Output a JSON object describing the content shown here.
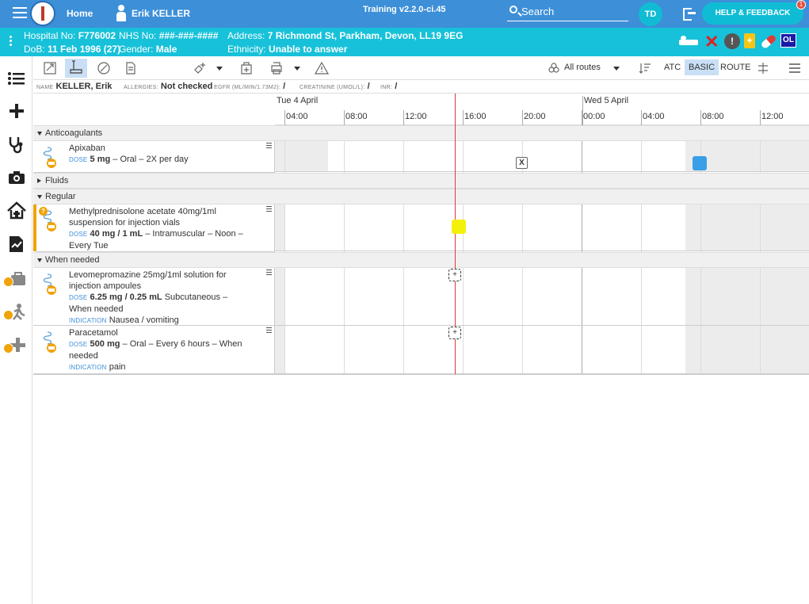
{
  "topbar": {
    "home_label": "Home",
    "patient_name": "Erik KELLER",
    "environment": "Training v2.2.0-ci.45",
    "search_placeholder": "Search",
    "user_initials": "TD",
    "help_label": "HELP & FEEDBACK",
    "notification_count": "1",
    "bg_color": "#3d8fd8"
  },
  "patient": {
    "hospital_no_label": "Hospital No:",
    "hospital_no": "F776002",
    "nhs_label": "NHS No:",
    "nhs_no": "###-###-####",
    "address_label": "Address:",
    "address": "7 Richmond St, Parkham, Devon, LL19 9EG",
    "dob_label": "DoB:",
    "dob": "11 Feb 1996 (27)",
    "gender_label": "Gender:",
    "gender": "Male",
    "ethnicity_label": "Ethnicity:",
    "ethnicity": "Unable to answer",
    "bg_color": "#17c1d9",
    "status_ol": "OL"
  },
  "toolbar": {
    "routes_label": "All routes",
    "atc_label": "ATC",
    "basic_label": "BASIC",
    "route_label": "ROUTE"
  },
  "infobar": {
    "name_key": "NAME",
    "name_value": "KELLER, Erik",
    "allergies_key": "ALLERGIES:",
    "allergies_value": "Not checked",
    "egfr_key": "EGFR (ML/MIN/1.73M2):",
    "egfr_value": "/",
    "creat_key": "CREATININE (UMOL/L):",
    "creat_value": "/",
    "inr_key": "INR:",
    "inr_value": "/"
  },
  "timeline": {
    "day1": "Tue 4 April",
    "day2": "Wed 5 April",
    "ticks": [
      "04:00",
      "08:00",
      "12:00",
      "16:00",
      "20:00",
      "00:00",
      "04:00",
      "08:00",
      "12:00"
    ]
  },
  "sections": {
    "anticoagulants": "Anticoagulants",
    "fluids": "Fluids",
    "regular": "Regular",
    "when_needed": "When needed"
  },
  "labels": {
    "dose": "DOSE",
    "indication": "INDICATION"
  },
  "meds": [
    {
      "name": "Apixaban",
      "dose": "5 mg",
      "rest": " – Oral – 2X per day",
      "indication": ""
    },
    {
      "name": "Methylprednisolone acetate 40mg/1ml suspension for injection vials",
      "dose": "40 mg / 1 mL",
      "rest": " – Intramuscular – Noon – Every Tue",
      "indication": ""
    },
    {
      "name": "Levomepromazine 25mg/1ml solution for injection ampoules",
      "dose": "6.25 mg / 0.25 mL",
      "rest": " Subcutaneous – When needed",
      "indication": "Nausea / vomiting"
    },
    {
      "name": "Paracetamol",
      "dose": "500 mg",
      "rest": " – Oral – Every 6 hours – When needed",
      "indication": "pain"
    }
  ],
  "marks": {
    "missed": "X",
    "add": "+",
    "given_color": "#3a9ee8",
    "due_color": "#f5f00a"
  }
}
